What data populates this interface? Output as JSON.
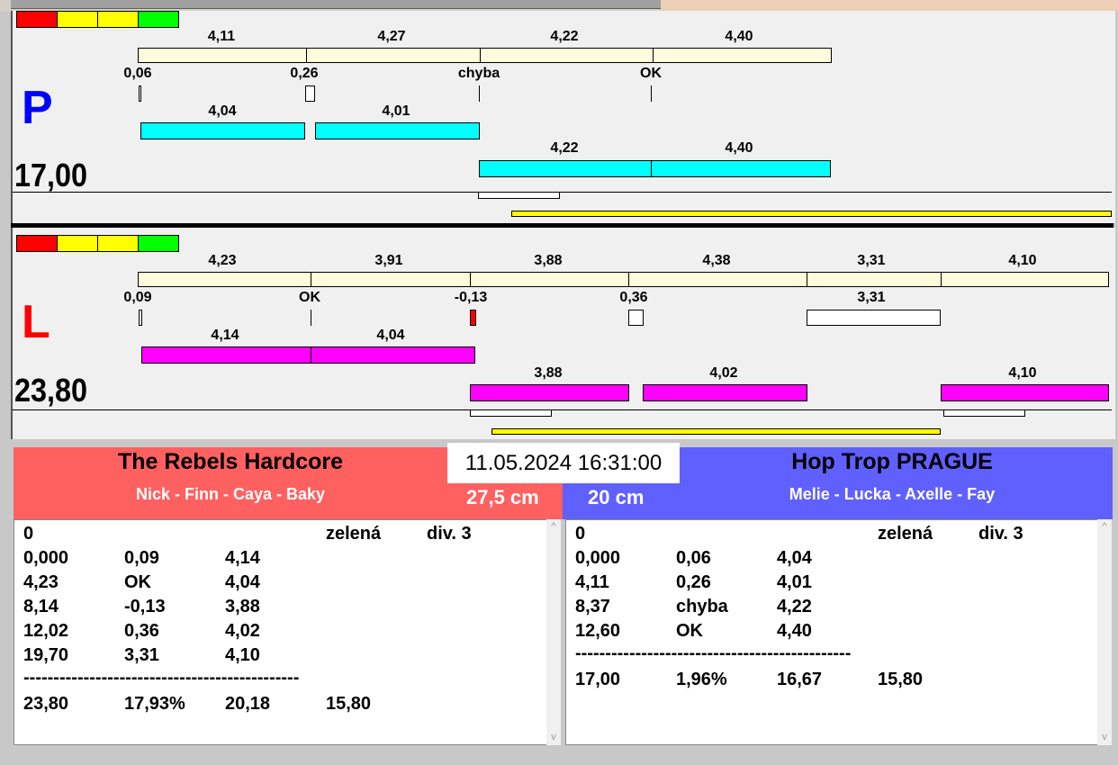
{
  "colors": {
    "red": "#ff0000",
    "yellow": "#ffff00",
    "green": "#00ff00",
    "cyan": "#00ffff",
    "magenta": "#ff00ff",
    "team_left": "#ff6060",
    "team_right": "#6060ff"
  },
  "P": {
    "letter": "P",
    "total": "17,00",
    "top_labels": [
      "4,11",
      "4,27",
      "4,22",
      "4,40"
    ],
    "sub_labels": [
      "0,06",
      "0,26",
      "chyba",
      "OK"
    ],
    "row1_labels": [
      "4,04",
      "4,01"
    ],
    "row2_labels": [
      "4,22",
      "4,40"
    ]
  },
  "L": {
    "letter": "L",
    "total": "23,80",
    "top_labels": [
      "4,23",
      "3,91",
      "3,88",
      "4,38",
      "3,31",
      "4,10"
    ],
    "sub_labels": [
      "0,09",
      "OK",
      "-0,13",
      "0,36",
      "3,31"
    ],
    "row1_labels": [
      "4,14",
      "4,04"
    ],
    "row2_labels": [
      "3,88",
      "4,02",
      "4,10"
    ]
  },
  "datetime": "11.05.2024 16:31:00",
  "left_team": {
    "name": "The Rebels Hardcore",
    "members": "Nick - Finn - Caya - Baky",
    "height": "27,5 cm",
    "rows": [
      [
        "0",
        "",
        "",
        "zelená",
        "div. 3"
      ],
      [
        "0,000",
        "0,09",
        "4,14"
      ],
      [
        "4,23",
        "OK",
        "4,04"
      ],
      [
        "8,14",
        "-0,13",
        "3,88"
      ],
      [
        "12,02",
        "0,36",
        "4,02"
      ],
      [
        "19,70",
        "3,31",
        "4,10"
      ],
      [
        "----------------------------------------------"
      ],
      [
        "23,80",
        "17,93%",
        "20,18",
        "15,80"
      ]
    ]
  },
  "right_team": {
    "name": "Hop Trop PRAGUE",
    "members": "Melie - Lucka - Axelle - Fay",
    "height": "20 cm",
    "rows": [
      [
        "0",
        "",
        "",
        "zelená",
        "div. 3"
      ],
      [
        "0,000",
        "0,06",
        "4,04"
      ],
      [
        "4,11",
        "0,26",
        "4,01"
      ],
      [
        "8,37",
        "chyba",
        "4,22"
      ],
      [
        "12,60",
        "OK",
        "4,40"
      ],
      [
        "----------------------------------------------"
      ],
      [
        "17,00",
        "1,96%",
        "16,67",
        "15,80"
      ]
    ]
  }
}
